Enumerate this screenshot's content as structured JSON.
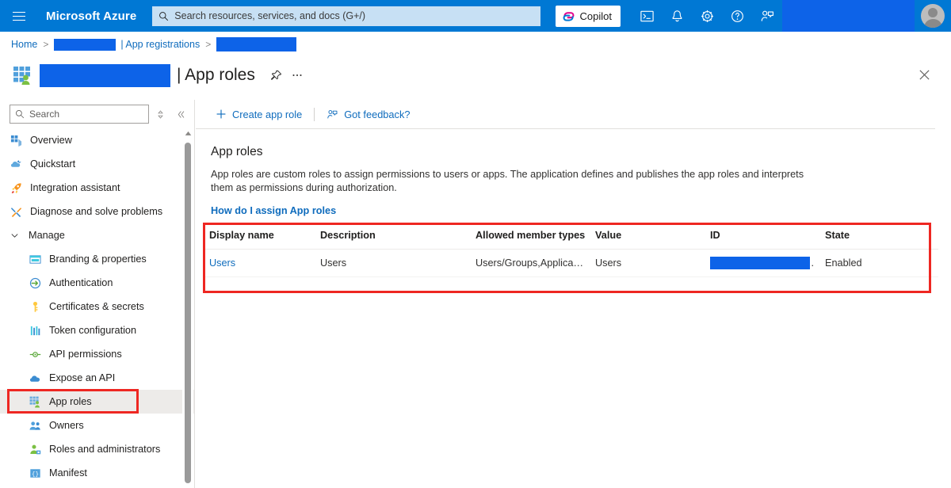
{
  "topbar": {
    "menu_icon": "hamburger-icon",
    "brand": "Microsoft Azure",
    "search_placeholder": "Search resources, services, and docs (G+/)",
    "search_icon": "search-icon",
    "copilot_label": "Copilot",
    "icons": [
      {
        "name": "cloud-shell-icon"
      },
      {
        "name": "notifications-bell-icon"
      },
      {
        "name": "settings-gear-icon"
      },
      {
        "name": "help-question-icon"
      },
      {
        "name": "feedback-person-icon"
      }
    ],
    "account_redacted": "",
    "avatar": "user-avatar"
  },
  "breadcrumb": {
    "home": "Home",
    "separator": ">",
    "redacted_tenant": "",
    "app_registrations": "| App registrations",
    "redacted_app": ""
  },
  "blade": {
    "title_redacted": "",
    "title": "| App roles",
    "pin_icon": "pin-icon",
    "more_icon": "ellipsis-icon",
    "close_icon": "close-icon",
    "blade_icon": "app-roles-icon"
  },
  "leftnav": {
    "search_placeholder": "Search",
    "search_icon": "search-icon",
    "sort_icon": "sort-icon",
    "collapse_icon": "collapse-chevrons-icon",
    "items": [
      {
        "label": "Overview",
        "icon": "overview-grid-icon",
        "type": "top"
      },
      {
        "label": "Quickstart",
        "icon": "quickstart-cloud-icon",
        "type": "top"
      },
      {
        "label": "Integration assistant",
        "icon": "rocket-icon",
        "type": "top"
      },
      {
        "label": "Diagnose and solve problems",
        "icon": "wrench-screwdriver-icon",
        "type": "top"
      },
      {
        "label": "Manage",
        "icon": "chevron-down-icon",
        "type": "group"
      },
      {
        "label": "Branding & properties",
        "icon": "branding-window-icon",
        "type": "sub"
      },
      {
        "label": "Authentication",
        "icon": "authentication-arrow-icon",
        "type": "sub"
      },
      {
        "label": "Certificates & secrets",
        "icon": "key-icon",
        "type": "sub"
      },
      {
        "label": "Token configuration",
        "icon": "token-bars-icon",
        "type": "sub"
      },
      {
        "label": "API permissions",
        "icon": "api-permissions-icon",
        "type": "sub"
      },
      {
        "label": "Expose an API",
        "icon": "expose-api-cloud-icon",
        "type": "sub"
      },
      {
        "label": "App roles",
        "icon": "app-roles-icon",
        "type": "sub",
        "selected": true,
        "highlighted": true
      },
      {
        "label": "Owners",
        "icon": "owners-people-icon",
        "type": "sub"
      },
      {
        "label": "Roles and administrators",
        "icon": "roles-admin-icon",
        "type": "sub"
      },
      {
        "label": "Manifest",
        "icon": "manifest-braces-icon",
        "type": "sub"
      }
    ]
  },
  "toolbar": {
    "create_label": "Create app role",
    "create_icon": "plus-icon",
    "feedback_label": "Got feedback?",
    "feedback_icon": "feedback-person-icon"
  },
  "main": {
    "heading": "App roles",
    "description": "App roles are custom roles to assign permissions to users or apps. The application defines and publishes the app roles and interprets them as permissions during authorization.",
    "help_link": "How do I assign App roles"
  },
  "table": {
    "columns": [
      "Display name",
      "Description",
      "Allowed member types",
      "Value",
      "ID",
      "State"
    ],
    "rows": [
      {
        "display_name": "Users",
        "description": "Users",
        "allowed_member_types": "Users/Groups,Applicatio...",
        "value": "Users",
        "id_redacted": "",
        "id_suffix": ".",
        "state": "Enabled"
      }
    ]
  },
  "colors": {
    "azure_blue": "#0078D4",
    "redaction_blue": "#0D63E8",
    "highlight_red": "#EE2722",
    "link_blue": "#0F6CBD",
    "search_bar": "#C7E0F4",
    "selected_row": "#edebe9"
  }
}
